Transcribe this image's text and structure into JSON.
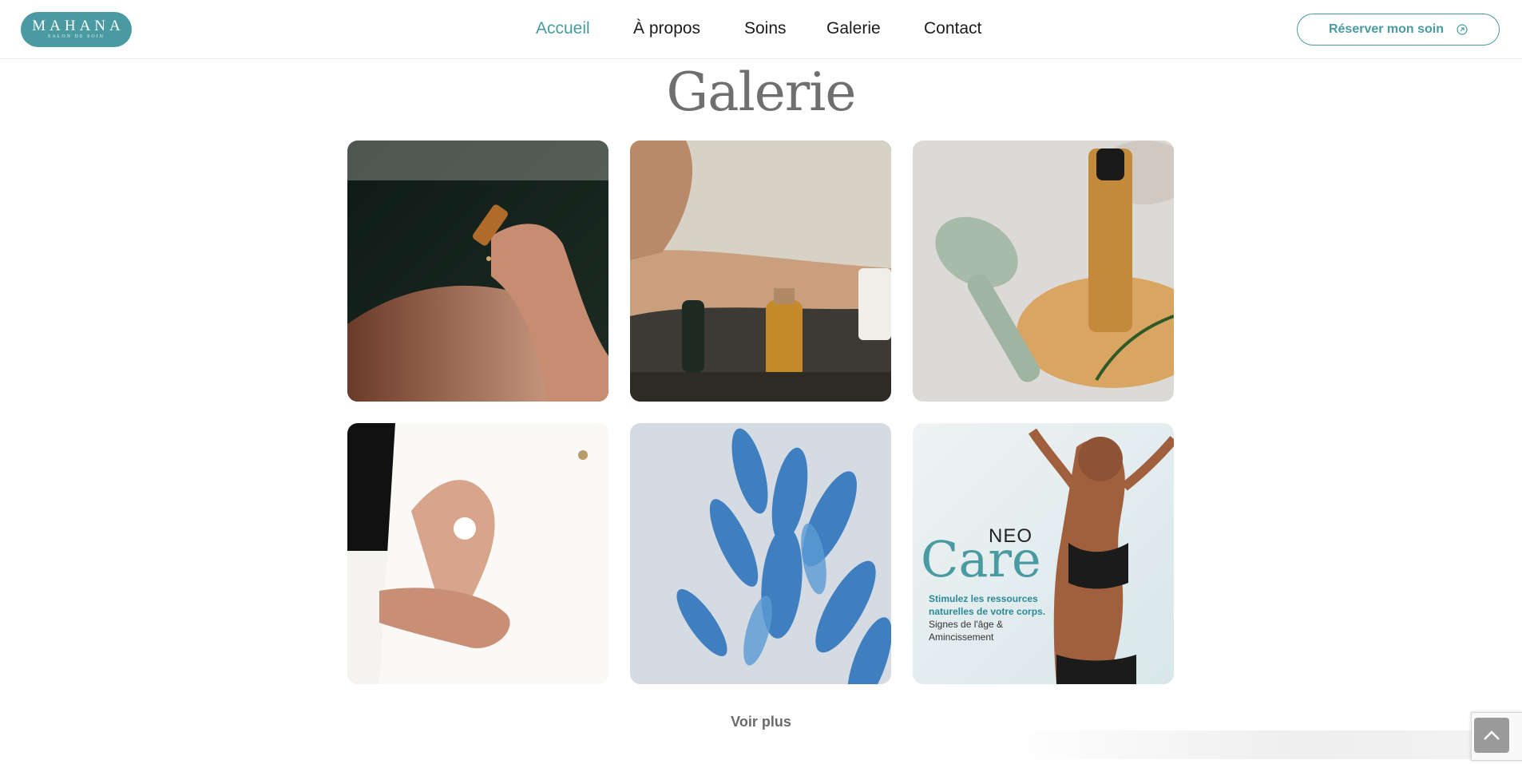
{
  "brand": {
    "name": "MAHANA",
    "tagline": "SALON DE SOIN",
    "color": "#4a9aa2"
  },
  "nav": {
    "items": [
      {
        "label": "Accueil",
        "active": true
      },
      {
        "label": "À propos",
        "active": false
      },
      {
        "label": "Soins",
        "active": false
      },
      {
        "label": "Galerie",
        "active": false
      },
      {
        "label": "Contact",
        "active": false
      }
    ],
    "cta_label": "Réserver mon soin",
    "cta_icon": "arrow-up-right-circle-icon"
  },
  "gallery": {
    "title": "Galerie",
    "images": [
      {
        "name": "serum-dropper-hands-photo"
      },
      {
        "name": "oil-bottles-arm-photo"
      },
      {
        "name": "jade-roller-serum-photo"
      },
      {
        "name": "hands-cream-photo"
      },
      {
        "name": "blue-bunny-tails-photo"
      },
      {
        "name": "neo-care-promo",
        "brand_small": "NEO",
        "brand_big": "Care",
        "line1": "Stimulez les ressources",
        "line2": "naturelles de votre corps.",
        "line3": "Signes de l'âge &",
        "line4": "Amincissement"
      }
    ],
    "more_label": "Voir plus"
  },
  "widgets": {
    "scroll_top_icon": "chevron-up-icon",
    "recaptcha_icon": "recaptcha-icon"
  }
}
